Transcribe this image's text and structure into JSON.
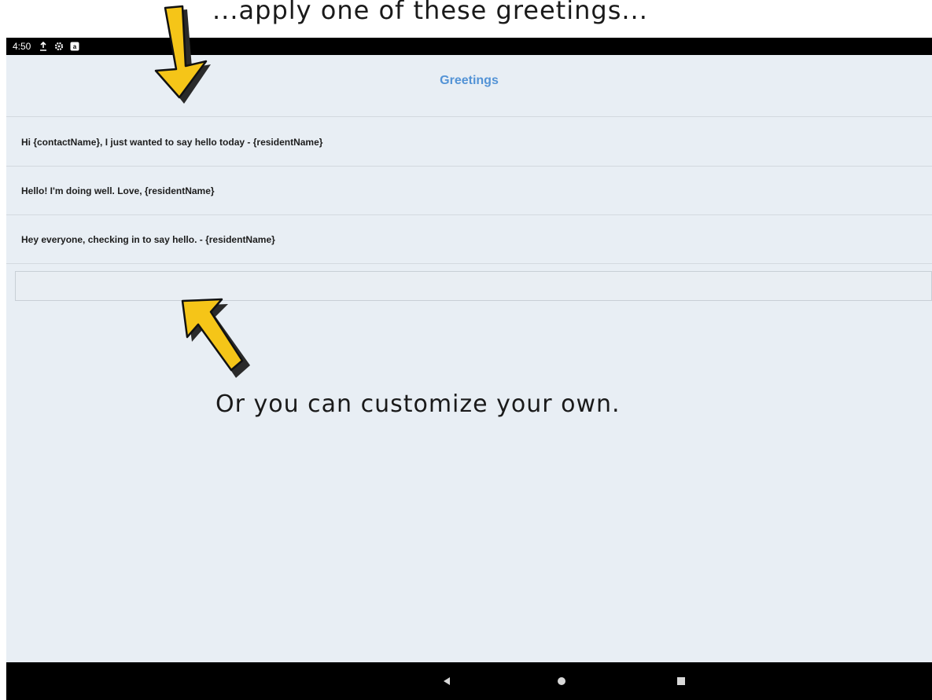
{
  "overlay": {
    "top_text": "...apply one of these greetings...",
    "caption": "Or you can customize your own."
  },
  "status_bar": {
    "time": "4:50",
    "icons": [
      "upload-icon",
      "settings-icon",
      "amazon-icon"
    ]
  },
  "screen": {
    "title": "Greetings",
    "greetings": [
      "Hi {contactName}, I just wanted to say hello today - {residentName}",
      "Hello! I'm doing well. Love, {residentName}",
      "Hey everyone, checking in to say hello. - {residentName}"
    ],
    "custom_input": {
      "value": "",
      "placeholder": ""
    }
  },
  "nav_bar": {
    "buttons": [
      "back-icon",
      "home-icon",
      "recents-icon"
    ]
  },
  "colors": {
    "accent": "#5393d6",
    "background": "#e8eef4",
    "arrow_fill": "#f5c518",
    "arrow_shadow": "#2a2a2a"
  }
}
